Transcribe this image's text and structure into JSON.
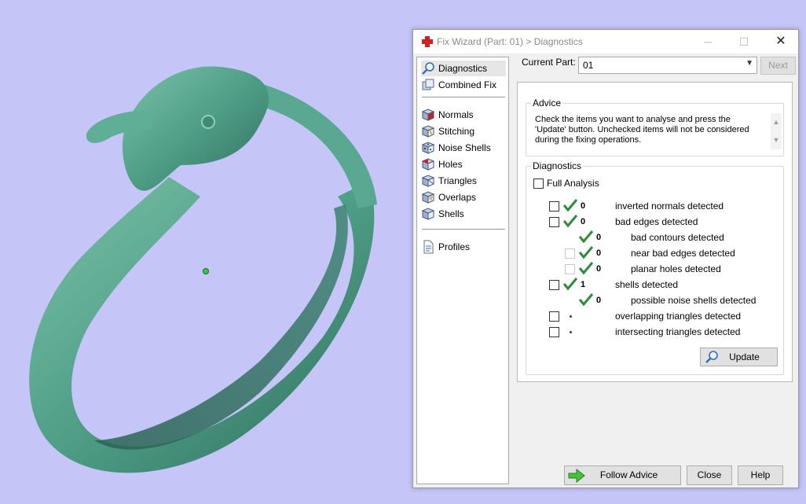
{
  "window": {
    "title": "Fix Wizard (Part: 01) > Diagnostics",
    "minimize": "─",
    "maximize": "☐",
    "close": "✕"
  },
  "nav": {
    "items": [
      {
        "label": "Diagnostics",
        "icon": "magnifier-icon"
      },
      {
        "label": "Combined Fix",
        "icon": "combined-fix-icon"
      },
      {
        "label": "Normals",
        "icon": "normals-cube-icon"
      },
      {
        "label": "Stitching",
        "icon": "stitching-cube-icon"
      },
      {
        "label": "Noise Shells",
        "icon": "noise-shells-cube-icon"
      },
      {
        "label": "Holes",
        "icon": "holes-cube-icon"
      },
      {
        "label": "Triangles",
        "icon": "triangles-cube-icon"
      },
      {
        "label": "Overlaps",
        "icon": "overlaps-cube-icon"
      },
      {
        "label": "Shells",
        "icon": "shells-cube-icon"
      },
      {
        "label": "Profiles",
        "icon": "document-icon"
      }
    ],
    "selected": "Diagnostics"
  },
  "part": {
    "label": "Current Part:",
    "value": "01",
    "next_label": "Next"
  },
  "advice": {
    "legend": "Advice",
    "text": "Check the items you want to analyse and press the 'Update' button. Unchecked items will not be considered during the fixing operations."
  },
  "diagnostics": {
    "legend": "Diagnostics",
    "full_analysis_label": "Full Analysis",
    "rows": [
      {
        "count": "0",
        "label": "inverted normals detected",
        "status": "ok"
      },
      {
        "count": "0",
        "label": "bad edges detected",
        "status": "ok"
      },
      {
        "count": "0",
        "label": "bad contours detected",
        "status": "ok"
      },
      {
        "count": "0",
        "label": "near bad edges detected",
        "status": "ok"
      },
      {
        "count": "0",
        "label": "planar holes detected",
        "status": "ok"
      },
      {
        "count": "1",
        "label": "shells detected",
        "status": "ok"
      },
      {
        "count": "0",
        "label": "possible noise shells detected",
        "status": "ok"
      },
      {
        "count": "",
        "label": "overlapping triangles detected",
        "status": "pending"
      },
      {
        "count": "",
        "label": "intersecting triangles detected",
        "status": "pending"
      }
    ],
    "update_label": "Update"
  },
  "footer": {
    "follow_advice_label": "Follow Advice",
    "close_label": "Close",
    "help_label": "Help"
  },
  "colors": {
    "background": "#c5c5f8",
    "model": "#4f9e86",
    "ok_check": "#2e8b3a",
    "pending_dot": "#2233aa"
  }
}
